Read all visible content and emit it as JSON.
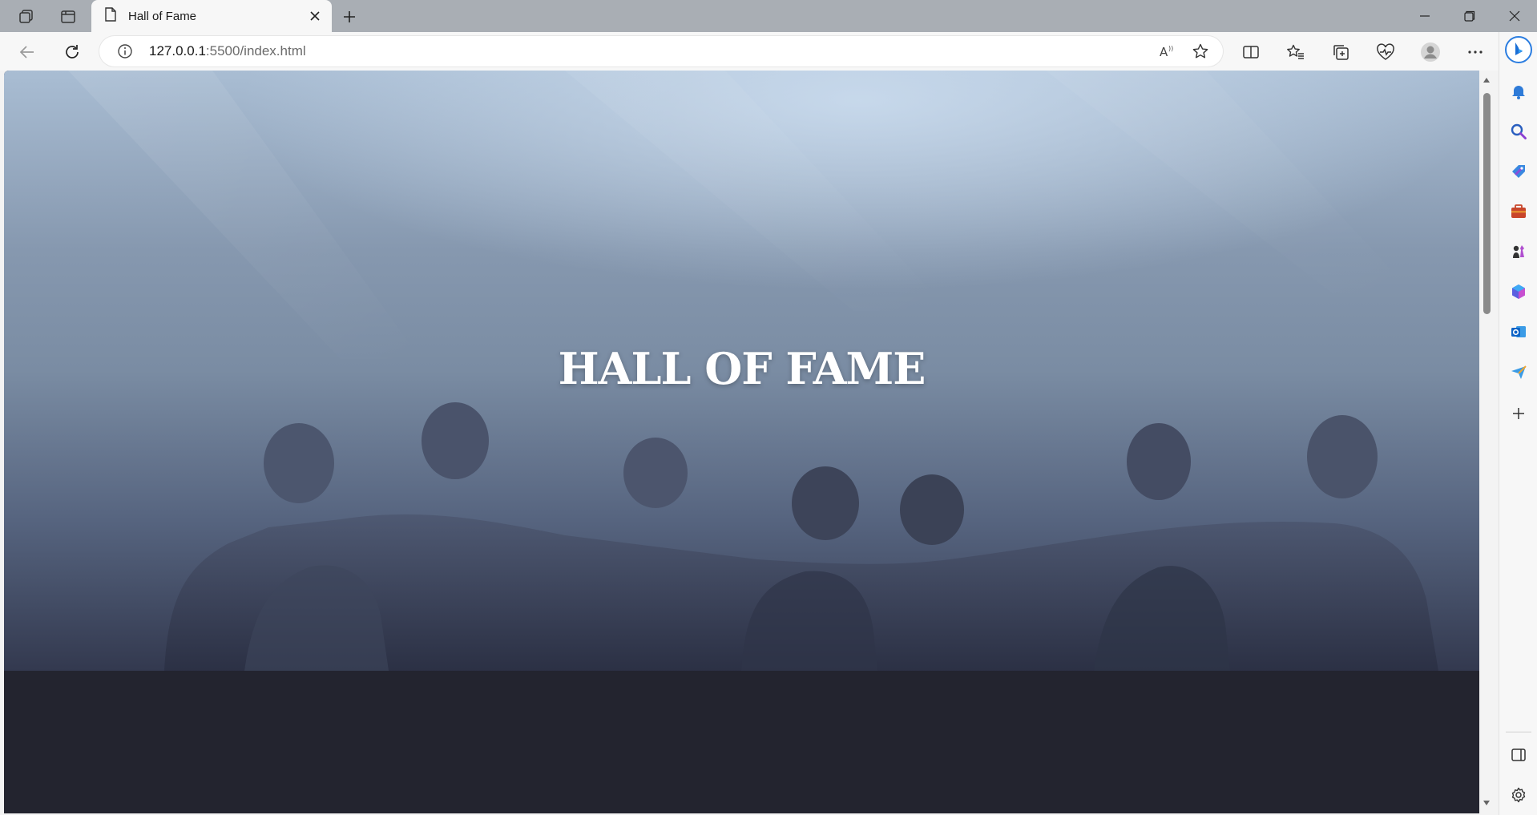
{
  "browser": {
    "tab": {
      "title": "Hall of Fame"
    },
    "address": {
      "host": "127.0.0.1",
      "rest": ":5500/index.html"
    },
    "icons": {
      "workspaces": "workspaces-icon",
      "tab_actions": "tab-actions-icon",
      "page": "page-icon",
      "close": "close-icon",
      "new_tab": "plus-icon",
      "back": "back-arrow-icon",
      "refresh": "refresh-icon",
      "info": "info-icon",
      "read_aloud": "read-aloud-icon",
      "favorite": "star-icon",
      "split_screen": "split-screen-icon",
      "favorites": "favorites-icon",
      "collections": "collections-icon",
      "health": "browser-essentials-icon",
      "profile": "profile-icon",
      "more": "more-icon",
      "copilot": "copilot-icon"
    },
    "sidebar_icons": [
      "bell-icon",
      "search-icon",
      "tag-icon",
      "briefcase-icon",
      "chess-icon",
      "m365-icon",
      "outlook-icon",
      "send-icon",
      "add-icon",
      "sidebar-toggle-icon",
      "settings-icon"
    ]
  },
  "page": {
    "hero_title": "HALL OF FAME"
  },
  "colors": {
    "footer_bg": "#23242f",
    "hero_top": "#a9bdd3",
    "hero_bottom": "#33394f"
  }
}
